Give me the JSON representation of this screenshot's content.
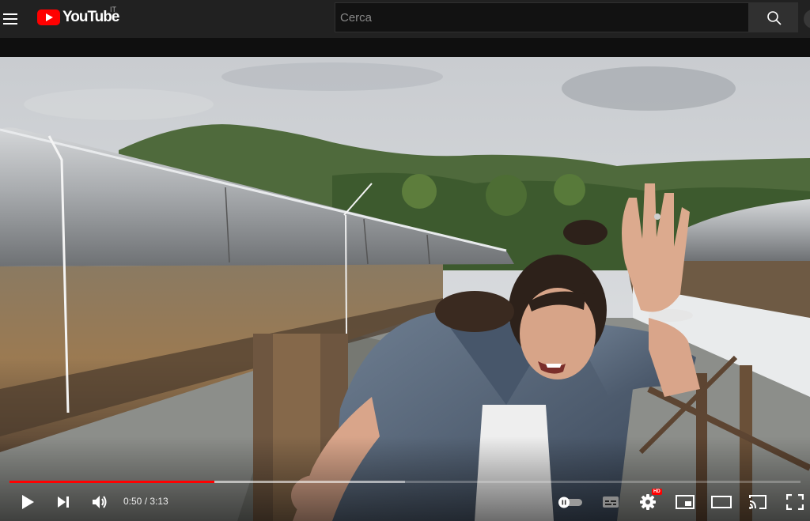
{
  "masthead": {
    "logo_text": "YouTube",
    "country_code": "IT",
    "search_placeholder": "Cerca"
  },
  "player": {
    "time_current": "0:50",
    "time_separator": " / ",
    "time_duration": "3:13",
    "progress_played": 0.259,
    "progress_buffered": 0.5,
    "hd_badge": "HD",
    "accent_color": "#ff0000",
    "controls": [
      "play-icon",
      "next-icon",
      "volume-icon",
      "autoplay-toggle-icon",
      "subtitles-icon",
      "settings-icon",
      "miniplayer-icon",
      "theater-mode-icon",
      "cast-icon",
      "fullscreen-icon"
    ]
  }
}
